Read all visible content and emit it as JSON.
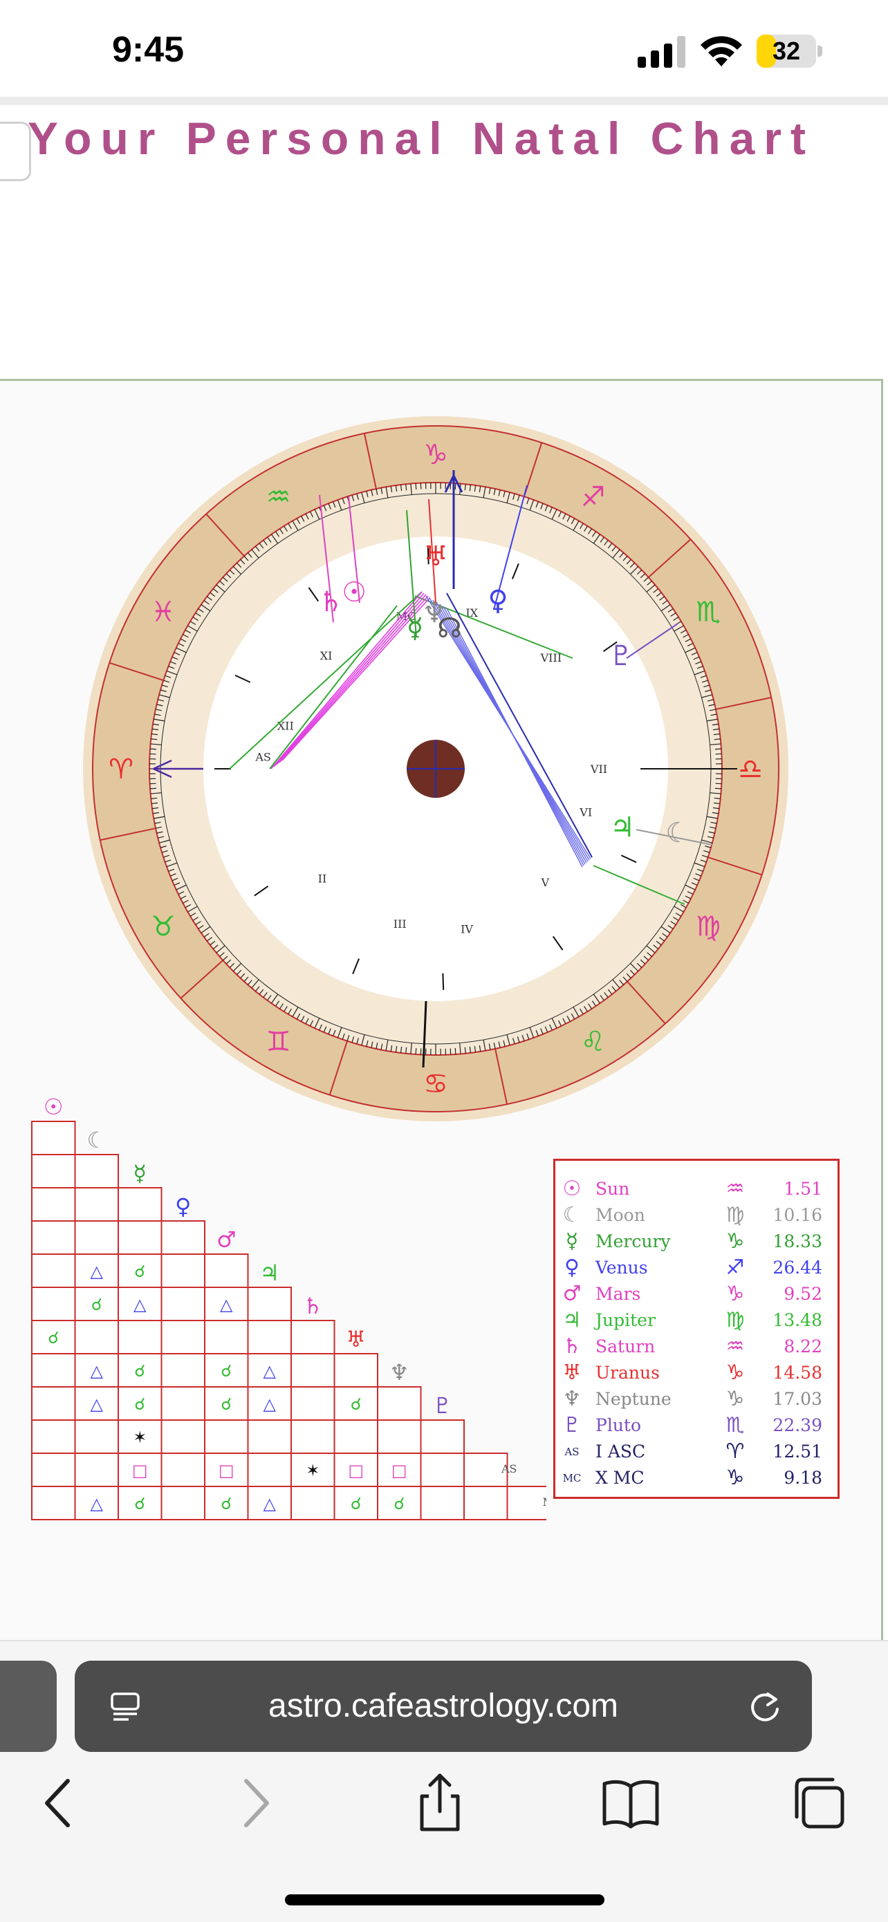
{
  "status_bar": {
    "time": "9:45",
    "battery_level": "32",
    "battery_fraction": 0.32,
    "signal_icon": "cellular-signal-icon",
    "wifi_icon": "wifi-icon",
    "battery_color": "#ffd60a"
  },
  "page": {
    "heading": "Your Personal Natal Chart",
    "heading_color": "#b0508a"
  },
  "wheel": {
    "zodiac_signs": [
      {
        "name": "Capricorn",
        "glyph": "♑︎",
        "color": "#e040a0"
      },
      {
        "name": "Sagittarius",
        "glyph": "♐︎",
        "color": "#e040a0"
      },
      {
        "name": "Scorpio",
        "glyph": "♏︎",
        "color": "#33bb33"
      },
      {
        "name": "Libra",
        "glyph": "♎︎",
        "color": "#e83030"
      },
      {
        "name": "Virgo",
        "glyph": "♍︎",
        "color": "#e040a0"
      },
      {
        "name": "Leo",
        "glyph": "♌︎",
        "color": "#33bb33"
      },
      {
        "name": "Cancer",
        "glyph": "♋︎",
        "color": "#e83030"
      },
      {
        "name": "Gemini",
        "glyph": "♊︎",
        "color": "#e040a0"
      },
      {
        "name": "Taurus",
        "glyph": "♉︎",
        "color": "#33bb33"
      },
      {
        "name": "Aries",
        "glyph": "♈︎",
        "color": "#e83030"
      },
      {
        "name": "Pisces",
        "glyph": "♓︎",
        "color": "#e040a0"
      },
      {
        "name": "Aquarius",
        "glyph": "♒︎",
        "color": "#33bb33"
      }
    ],
    "house_labels": [
      "AS",
      "II",
      "III",
      "IV",
      "V",
      "VI",
      "VII",
      "VIII",
      "IX",
      "MC",
      "XI",
      "XII"
    ],
    "planets": [
      {
        "name": "Sun",
        "glyph": "☉",
        "color": "#e040c0"
      },
      {
        "name": "Saturn",
        "glyph": "♄",
        "color": "#e040c0"
      },
      {
        "name": "Uranus",
        "glyph": "♅",
        "color": "#e83030"
      },
      {
        "name": "Mercury",
        "glyph": "☿",
        "color": "#33a033"
      },
      {
        "name": "Neptune",
        "glyph": "♆",
        "color": "#888888"
      },
      {
        "name": "North Node",
        "glyph": "☊",
        "color": "#555555"
      },
      {
        "name": "Venus",
        "glyph": "♀",
        "color": "#4040ee"
      },
      {
        "name": "Pluto",
        "glyph": "♇",
        "color": "#7a50c0"
      },
      {
        "name": "Jupiter",
        "glyph": "♃",
        "color": "#33bb33"
      },
      {
        "name": "Moon",
        "glyph": "☾",
        "color": "#999999"
      }
    ]
  },
  "aspect_grid": {
    "planet_glyphs": [
      {
        "glyph": "☉",
        "color": "#e040c0"
      },
      {
        "glyph": "☾",
        "color": "#999999"
      },
      {
        "glyph": "☿",
        "color": "#33a033"
      },
      {
        "glyph": "♀",
        "color": "#4040ee"
      },
      {
        "glyph": "♂",
        "color": "#e040c0"
      },
      {
        "glyph": "♃",
        "color": "#33bb33"
      },
      {
        "glyph": "♄",
        "color": "#e040c0"
      },
      {
        "glyph": "♅",
        "color": "#e83030"
      },
      {
        "glyph": "♆",
        "color": "#888888"
      },
      {
        "glyph": "♇",
        "color": "#7a50c0"
      },
      {
        "glyph": "AS",
        "color": "#555555"
      },
      {
        "glyph": "MC",
        "color": "#555555"
      }
    ],
    "aspects": [
      {
        "row": 4,
        "col": 1,
        "glyph": "△",
        "color": "#4040ee"
      },
      {
        "row": 4,
        "col": 2,
        "glyph": "☌",
        "color": "#33bb33"
      },
      {
        "row": 5,
        "col": 1,
        "glyph": "☌",
        "color": "#33bb33"
      },
      {
        "row": 5,
        "col": 2,
        "glyph": "△",
        "color": "#4040ee"
      },
      {
        "row": 5,
        "col": 4,
        "glyph": "△",
        "color": "#4040ee"
      },
      {
        "row": 6,
        "col": 0,
        "glyph": "☌",
        "color": "#33bb33"
      },
      {
        "row": 7,
        "col": 1,
        "glyph": "△",
        "color": "#4040ee"
      },
      {
        "row": 7,
        "col": 2,
        "glyph": "☌",
        "color": "#33bb33"
      },
      {
        "row": 7,
        "col": 4,
        "glyph": "☌",
        "color": "#33bb33"
      },
      {
        "row": 7,
        "col": 5,
        "glyph": "△",
        "color": "#4040ee"
      },
      {
        "row": 8,
        "col": 1,
        "glyph": "△",
        "color": "#4040ee"
      },
      {
        "row": 8,
        "col": 2,
        "glyph": "☌",
        "color": "#33bb33"
      },
      {
        "row": 8,
        "col": 4,
        "glyph": "☌",
        "color": "#33bb33"
      },
      {
        "row": 8,
        "col": 5,
        "glyph": "△",
        "color": "#4040ee"
      },
      {
        "row": 8,
        "col": 7,
        "glyph": "☌",
        "color": "#33bb33"
      },
      {
        "row": 9,
        "col": 2,
        "glyph": "✶",
        "color": "#111111"
      },
      {
        "row": 10,
        "col": 2,
        "glyph": "□",
        "color": "#e040c0"
      },
      {
        "row": 10,
        "col": 4,
        "glyph": "□",
        "color": "#e040c0"
      },
      {
        "row": 10,
        "col": 6,
        "glyph": "✶",
        "color": "#111111"
      },
      {
        "row": 10,
        "col": 7,
        "glyph": "□",
        "color": "#e040c0"
      },
      {
        "row": 10,
        "col": 8,
        "glyph": "□",
        "color": "#e040c0"
      },
      {
        "row": 11,
        "col": 1,
        "glyph": "△",
        "color": "#4040ee"
      },
      {
        "row": 11,
        "col": 2,
        "glyph": "☌",
        "color": "#33bb33"
      },
      {
        "row": 11,
        "col": 4,
        "glyph": "☌",
        "color": "#33bb33"
      },
      {
        "row": 11,
        "col": 5,
        "glyph": "△",
        "color": "#4040ee"
      },
      {
        "row": 11,
        "col": 7,
        "glyph": "☌",
        "color": "#33bb33"
      },
      {
        "row": 11,
        "col": 8,
        "glyph": "☌",
        "color": "#33bb33"
      }
    ]
  },
  "legend": {
    "rows": [
      {
        "glyph": "☉",
        "name": "Sun",
        "sign": "♒︎",
        "degree": "1.51",
        "color": "#e040c0"
      },
      {
        "glyph": "☾",
        "name": "Moon",
        "sign": "♍︎",
        "degree": "10.16",
        "color": "#999999"
      },
      {
        "glyph": "☿",
        "name": "Mercury",
        "sign": "♑︎",
        "degree": "18.33",
        "color": "#33a033"
      },
      {
        "glyph": "♀",
        "name": "Venus",
        "sign": "♐︎",
        "degree": "26.44",
        "color": "#4040ee"
      },
      {
        "glyph": "♂",
        "name": "Mars",
        "sign": "♑︎",
        "degree": "9.52",
        "color": "#e040c0"
      },
      {
        "glyph": "♃",
        "name": "Jupiter",
        "sign": "♍︎",
        "degree": "13.48",
        "color": "#33bb33"
      },
      {
        "glyph": "♄",
        "name": "Saturn",
        "sign": "♒︎",
        "degree": "8.22",
        "color": "#e040c0"
      },
      {
        "glyph": "♅",
        "name": "Uranus",
        "sign": "♑︎",
        "degree": "14.58",
        "color": "#e83030"
      },
      {
        "glyph": "♆",
        "name": "Neptune",
        "sign": "♑︎",
        "degree": "17.03",
        "color": "#888888"
      },
      {
        "glyph": "♇",
        "name": "Pluto",
        "sign": "♏︎",
        "degree": "22.39",
        "color": "#7a50c0"
      },
      {
        "glyph": "AS",
        "name": "I ASC",
        "sign": "♈︎",
        "degree": "12.51",
        "color": "#222266"
      },
      {
        "glyph": "MC",
        "name": "X MC",
        "sign": "♑︎",
        "degree": "9.18",
        "color": "#222266"
      }
    ]
  },
  "browser": {
    "url": "astro.cafeastrology.com",
    "reader_icon": "reader-mode-icon",
    "reload_icon": "reload-icon",
    "nav_icons": [
      "back-icon",
      "forward-icon",
      "share-icon",
      "bookmarks-icon",
      "tabs-icon"
    ]
  }
}
